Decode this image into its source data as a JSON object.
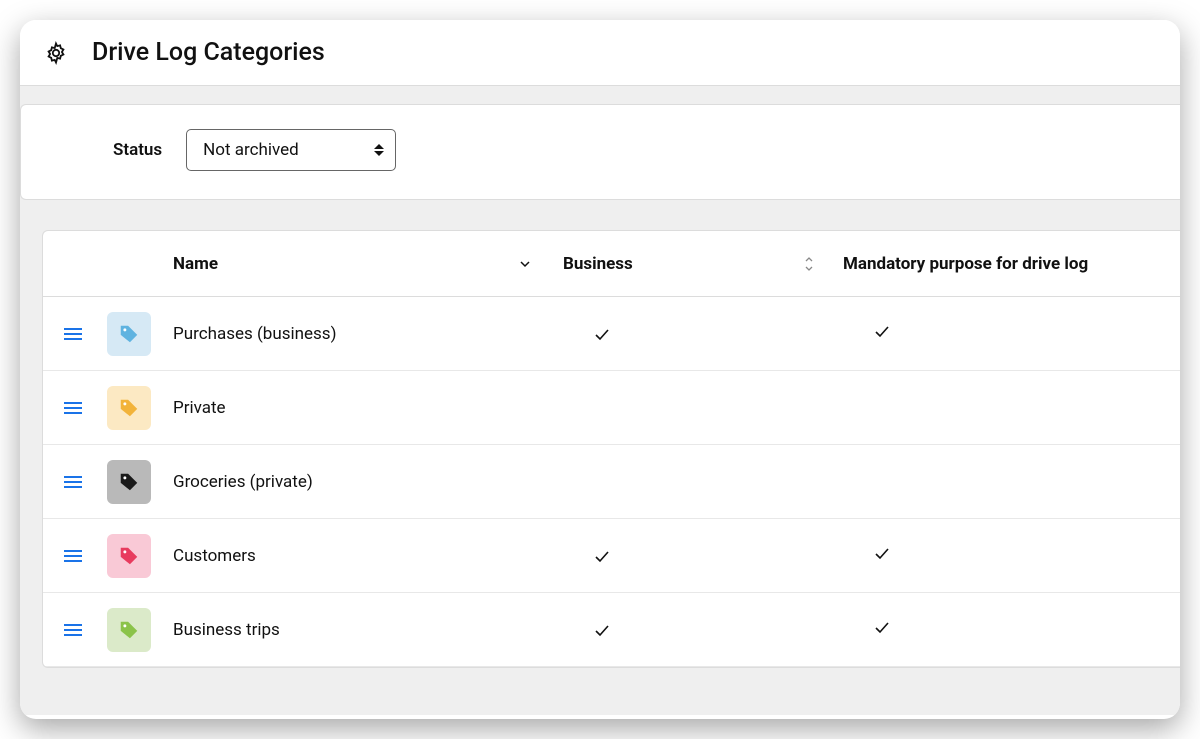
{
  "header": {
    "title": "Drive Log Categories"
  },
  "filter": {
    "label": "Status",
    "selected": "Not archived"
  },
  "table": {
    "columns": {
      "name": "Name",
      "business": "Business",
      "mandatory": "Mandatory purpose for drive log"
    },
    "rows": [
      {
        "name": "Purchases (business)",
        "business": true,
        "mandatory": true,
        "tag_bg_class": "tag-lightblue",
        "tag_color": "#5fb3e0"
      },
      {
        "name": "Private",
        "business": false,
        "mandatory": false,
        "tag_bg_class": "tag-lightorange",
        "tag_color": "#f2b33a"
      },
      {
        "name": "Groceries (private)",
        "business": false,
        "mandatory": false,
        "tag_bg_class": "tag-gray",
        "tag_color": "#1a1a1a"
      },
      {
        "name": "Customers",
        "business": true,
        "mandatory": true,
        "tag_bg_class": "tag-pink",
        "tag_color": "#e83b5e"
      },
      {
        "name": "Business trips",
        "business": true,
        "mandatory": true,
        "tag_bg_class": "tag-lightgreen",
        "tag_color": "#8bc34a"
      }
    ]
  }
}
